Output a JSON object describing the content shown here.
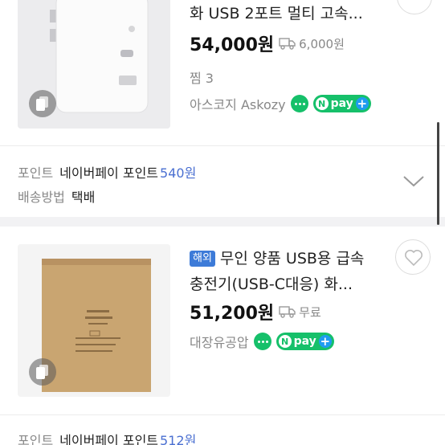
{
  "products": [
    {
      "title_line1": "화 USB 2포트 멀티 고속...",
      "price": "54,000원",
      "shipping": "6,000원",
      "wishlist": "찜 3",
      "seller": "아스코지 Askozy",
      "npay": "pay",
      "point_label": "포인트",
      "point_name": "네이버페이 포인트",
      "point_value": "540원",
      "delivery_label": "배송방법",
      "delivery_value": "택배"
    },
    {
      "badge": "해외",
      "title_line1": "무인 양품 USB용 급속",
      "title_line2": "충전기(USB-C대응) 화...",
      "price": "51,200원",
      "shipping": "무료",
      "seller": "대장유공압",
      "npay": "pay",
      "point_label": "포인트",
      "point_name": "네이버페이 포인트",
      "point_value": "512원"
    }
  ],
  "colors": {
    "accent_green": "#16c06a",
    "point_blue": "#4a6fd1",
    "overseas_badge": "#3d7bd8"
  },
  "icons": [
    "gallery-icon",
    "truck-icon",
    "talk-icon",
    "npay-icon",
    "chevron-down-icon",
    "heart-icon"
  ]
}
